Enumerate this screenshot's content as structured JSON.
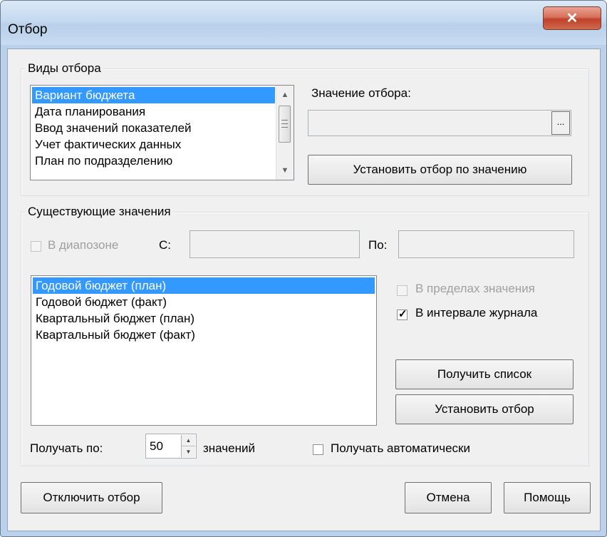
{
  "window": {
    "title": "Отбор"
  },
  "filter_types": {
    "legend": "Виды отбора",
    "items": [
      {
        "label": "Вариант бюджета",
        "selected": true
      },
      {
        "label": "Дата планирования",
        "selected": false
      },
      {
        "label": "Ввод значений показателей",
        "selected": false
      },
      {
        "label": "Учет фактических данных",
        "selected": false
      },
      {
        "label": "План по подразделению",
        "selected": false
      }
    ],
    "value_label": "Значение отбора:",
    "value": "",
    "ellipsis": "...",
    "set_by_value_label": "Установить отбор по значению"
  },
  "existing": {
    "legend": "Существующие значения",
    "range_label": "В диапозоне",
    "from_label": "С:",
    "to_label": "По:",
    "items": [
      {
        "label": "Годовой бюджет (план)",
        "selected": true
      },
      {
        "label": "Годовой бюджет (факт)",
        "selected": false
      },
      {
        "label": "Квартальный бюджет (план)",
        "selected": false
      },
      {
        "label": "Квартальный бюджет (факт)",
        "selected": false
      }
    ],
    "within_value_label": "В пределах значения",
    "in_journal_interval_label": "В интервале журнала",
    "get_list_label": "Получить список",
    "set_filter_label": "Установить отбор",
    "fetch_by_label": "Получать по:",
    "fetch_count": "50",
    "values_label": "значений",
    "auto_fetch_label": "Получать автоматически"
  },
  "footer": {
    "disable_filter_label": "Отключить отбор",
    "cancel_label": "Отмена",
    "help_label": "Помощь"
  }
}
